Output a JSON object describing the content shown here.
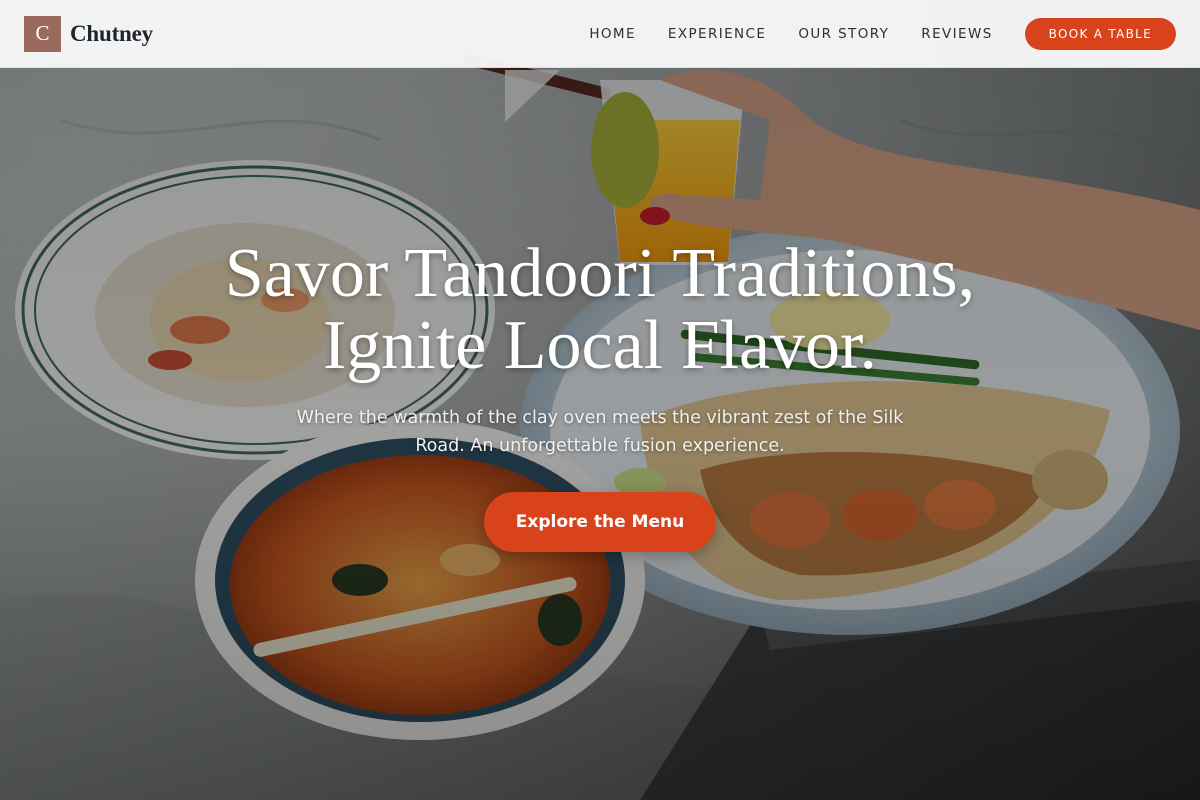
{
  "brand": {
    "logo_letter": "C",
    "name": "Chutney"
  },
  "nav": {
    "links": [
      "HOME",
      "EXPERIENCE",
      "OUR STORY",
      "REVIEWS"
    ],
    "book_label": "BOOK A TABLE"
  },
  "hero": {
    "title_line1": "Savor Tandoori Traditions,",
    "title_line2": "Ignite Local Flavor.",
    "subtitle": "Where the warmth of the clay oven meets the vibrant zest of the Silk Road. An unforgettable fusion experience.",
    "cta_label": "Explore the Menu",
    "image_subject": "food-spread-photo"
  },
  "colors": {
    "accent": "#d9431c",
    "logo_tile": "#9a6a5e",
    "header_bg": "#f8f8f8",
    "text_dark": "#1f2430"
  }
}
